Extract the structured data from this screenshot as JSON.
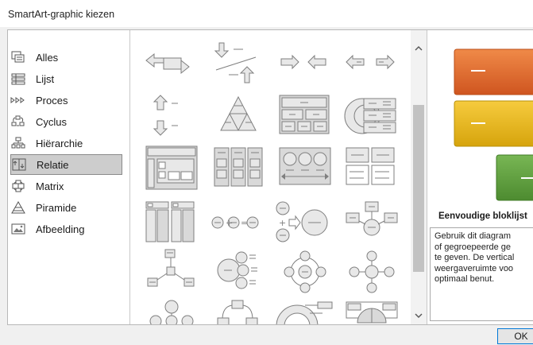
{
  "dialog": {
    "title": "SmartArt-graphic kiezen",
    "ok_label": "OK"
  },
  "categories": [
    {
      "label": "Alles",
      "icon": "all-layouts-icon",
      "selected": false
    },
    {
      "label": "Lijst",
      "icon": "list-icon",
      "selected": false
    },
    {
      "label": "Proces",
      "icon": "process-icon",
      "selected": false
    },
    {
      "label": "Cyclus",
      "icon": "cycle-icon",
      "selected": false
    },
    {
      "label": "Hiërarchie",
      "icon": "hierarchy-icon",
      "selected": false
    },
    {
      "label": "Relatie",
      "icon": "relationship-icon",
      "selected": true
    },
    {
      "label": "Matrix",
      "icon": "matrix-icon",
      "selected": false
    },
    {
      "label": "Piramide",
      "icon": "pyramid-icon",
      "selected": false
    },
    {
      "label": "Afbeelding",
      "icon": "picture-icon",
      "selected": false
    }
  ],
  "preview": {
    "title": "Eenvoudige bloklijst",
    "description_lines": [
      "Gebruik dit diagram",
      "of gegroepeerde ge",
      "te geven. De vertical",
      "weergaveruimte voo",
      "optimaal benut."
    ],
    "colors": {
      "orange": "#e0672a",
      "yellow": "#e9b716",
      "green": "#5b9d3d"
    }
  },
  "colors": {
    "accent": "#0078d7",
    "shape_fill": "#e8e8e8",
    "shape_stroke": "#7f7f7f"
  }
}
